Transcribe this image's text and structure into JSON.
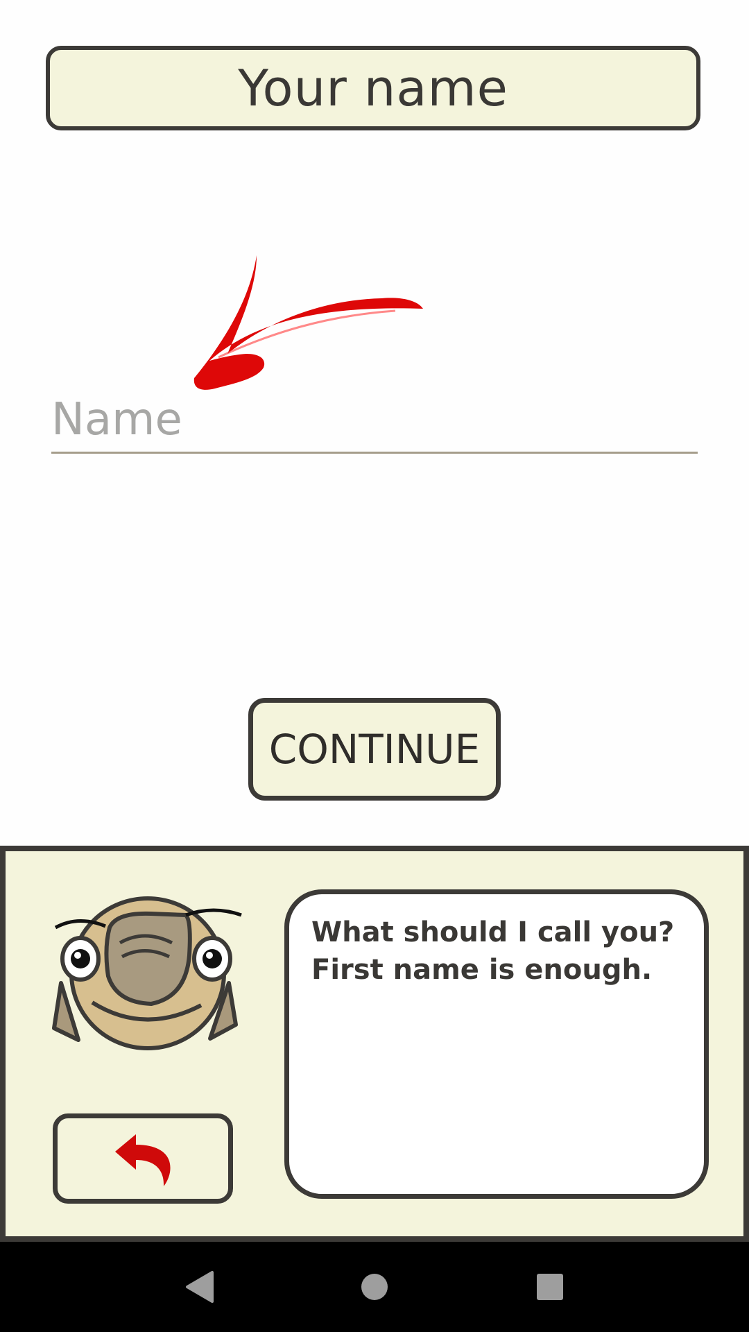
{
  "header": {
    "title": "Your name"
  },
  "form": {
    "name_placeholder": "Name",
    "name_value": ""
  },
  "actions": {
    "continue_label": "CONTINUE"
  },
  "assistant": {
    "message_line1": "What should I call you?",
    "message_line2": "First name is enough."
  },
  "icons": {
    "hint_arrow": "red-arrow-icon",
    "mascot": "sloth-avatar",
    "back": "undo-arrow-icon",
    "nav_back": "triangle-back-icon",
    "nav_home": "circle-home-icon",
    "nav_recents": "square-recents-icon"
  },
  "colors": {
    "panel_bg": "#f4f4dc",
    "border": "#3c3a37",
    "accent_red": "#d50000",
    "placeholder": "#a7a7a5"
  }
}
